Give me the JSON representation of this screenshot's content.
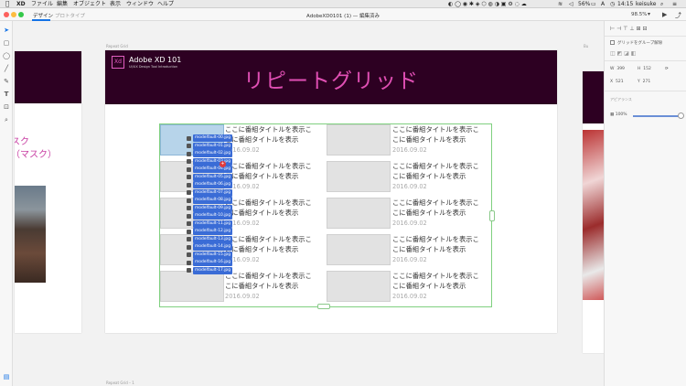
{
  "menubar": {
    "app_name": "XD",
    "menus": [
      "ファイル",
      "編集",
      "オブジェクト",
      "表示",
      "ウィンドウ",
      "ヘルプ"
    ],
    "battery": "56%",
    "clock": "14:15",
    "user": "keisuke"
  },
  "titlebar": {
    "tab_design": "デザイン",
    "tab_prototype": "プロトタイプ",
    "document_title": "AdobeXD0101 (1) — 編集済み",
    "zoom": "98.5%"
  },
  "canvas": {
    "artboard_main_label": "Repeat Grid",
    "artboard_right_label": "Bu",
    "selection_label": "Repeat Grid – 1",
    "left_artboard_text": "スク\n（マスク）",
    "hero": {
      "logo": "Xd",
      "title": "Adobe XD 101",
      "subtitle": "UI/UX Design Tool Introduction",
      "big_title": "リピートグリッド"
    },
    "grid_items": [
      {
        "line1": "ここに番組タイトルを表示こ",
        "line2": "こに番組タイトルを表示",
        "date": "2016.09.02"
      },
      {
        "line1": "ここに番組タイトルを表示こ",
        "line2": "こに番組タイトルを表示",
        "date": "2016.09.02"
      },
      {
        "line1": "ここに番組タイトルを表示こ",
        "line2": "こに番組タイトルを表示",
        "date": "2016.09.02"
      },
      {
        "line1": "ここに番組タイトルを表示こ",
        "line2": "こに番組タイトルを表示",
        "date": "2016.09.02"
      },
      {
        "line1": "ここに番組タイトルを表示こ",
        "line2": "こに番組タイトルを表示",
        "date": "2016.09.02"
      },
      {
        "line1": "ここに番組タイトルを表示こ",
        "line2": "こに番組タイトルを表示",
        "date": "2016.09.02"
      },
      {
        "line1": "ここに番組タイトルを表示こ",
        "line2": "こに番組タイトルを表示",
        "date": "2016.09.02"
      },
      {
        "line1": "ここに番組タイトルを表示こ",
        "line2": "こに番組タイトルを表示",
        "date": "2016.09.02"
      },
      {
        "line1": "ここに番組タイトルを表示こ",
        "line2": "こに番組タイトルを表示",
        "date": "2016.09.02"
      },
      {
        "line1": "ここに番組タイトルを表示こ",
        "line2": "こに番組タイトルを表示",
        "date": "2016.09.02"
      }
    ],
    "dragged_files": [
      "modelfault-00.jpg",
      "modelfault-01.jpg",
      "modelfault-02.jpg",
      "modelfault-03.jpg",
      "modelfault-04.jpg",
      "modelfault-05.jpg",
      "modelfault-06.jpg",
      "modelfault-07.jpg",
      "modelfault-08.jpg",
      "modelfault-09.jpg",
      "modelfault-10.jpg",
      "modelfault-11.jpg",
      "modelfault-12.jpg",
      "modelfault-13.jpg",
      "modelfault-14.jpg",
      "modelfault-15.jpg",
      "modelfault-16.jpg",
      "modelfault-17.jpg"
    ],
    "drag_badge": "+"
  },
  "panel": {
    "ungroup_label": "グリッドをグループ解除",
    "w_label": "W",
    "w_value": "399",
    "h_label": "H",
    "h_value": "152",
    "x_label": "X",
    "x_value": "521",
    "y_label": "Y",
    "y_value": "271",
    "appearance_label": "アピアランス",
    "opacity_value": "100%",
    "opacity_level": 1.0
  },
  "colors": {
    "accent": "#1473e6",
    "hero_bg": "#2d0022",
    "hero_text": "#e04fb4",
    "grid_outline": "#7fd07f",
    "file_chip": "#3a6cd6"
  }
}
